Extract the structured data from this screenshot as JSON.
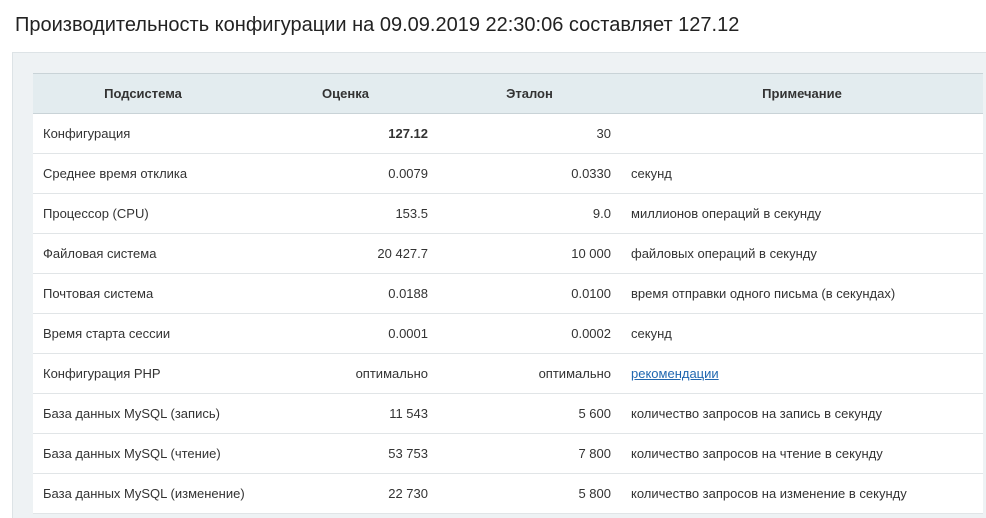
{
  "page": {
    "title": "Производительность конфигурации на 09.09.2019 22:30:06 составляет 127.12"
  },
  "table": {
    "headers": {
      "subsystem": "Подсистема",
      "score": "Оценка",
      "reference": "Эталон",
      "note": "Примечание"
    },
    "rows": [
      {
        "subsystem": "Конфигурация",
        "score": "127.12",
        "reference": "30",
        "note": ""
      },
      {
        "subsystem": "Среднее время отклика",
        "score": "0.0079",
        "reference": "0.0330",
        "note": "секунд"
      },
      {
        "subsystem": "Процессор (CPU)",
        "score": "153.5",
        "reference": "9.0",
        "note": "миллионов операций в секунду"
      },
      {
        "subsystem": "Файловая система",
        "score": "20 427.7",
        "reference": "10 000",
        "note": "файловых операций в секунду"
      },
      {
        "subsystem": "Почтовая система",
        "score": "0.0188",
        "reference": "0.0100",
        "note": "время отправки одного письма (в секундах)"
      },
      {
        "subsystem": "Время старта сессии",
        "score": "0.0001",
        "reference": "0.0002",
        "note": "секунд"
      },
      {
        "subsystem": "Конфигурация PHP",
        "score": "оптимально",
        "reference": "оптимально",
        "note": "рекомендации"
      },
      {
        "subsystem": "База данных MySQL (запись)",
        "score": "11 543",
        "reference": "5 600",
        "note": "количество запросов на запись в секунду"
      },
      {
        "subsystem": "База данных MySQL (чтение)",
        "score": "53 753",
        "reference": "7 800",
        "note": "количество запросов на чтение в секунду"
      },
      {
        "subsystem": "База данных MySQL (изменение)",
        "score": "22 730",
        "reference": "5 800",
        "note": "количество запросов на изменение в секунду"
      }
    ]
  },
  "colors": {
    "header_bg": "#e3ecef",
    "panel_bg": "#eef2f4",
    "link": "#2067b0"
  }
}
